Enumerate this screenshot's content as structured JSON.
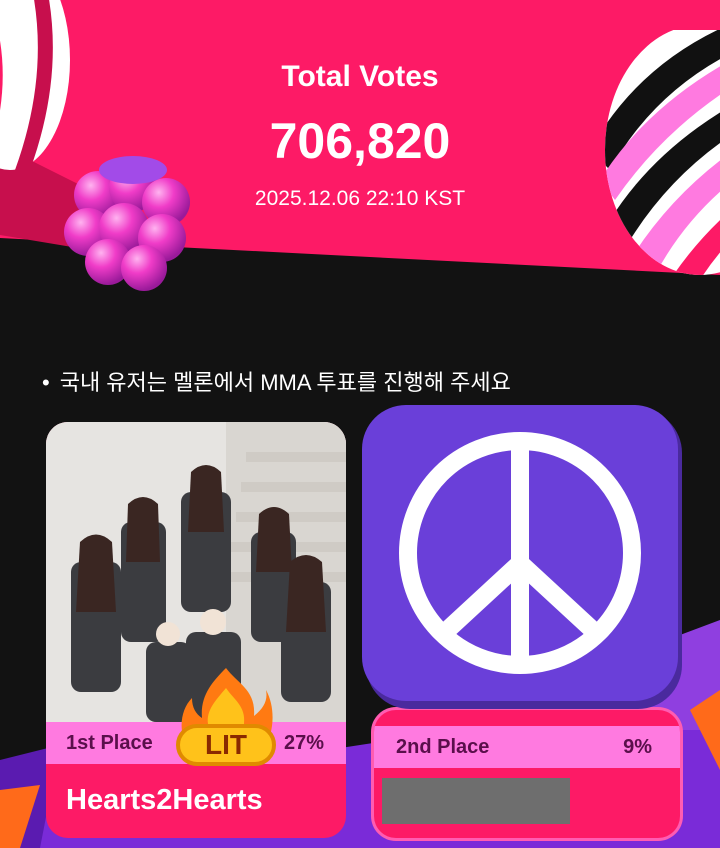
{
  "header": {
    "title": "Total Votes",
    "count": "706,820",
    "timestamp": "2025.12.06 22:10 KST"
  },
  "notice": {
    "bullet": "•",
    "text": "국내 유저는 멜론에서 MMA 투표를 진행해 주세요"
  },
  "candidates": [
    {
      "place": "1st Place",
      "percent": "27%",
      "name": "Hearts2Hearts",
      "badge": "LIT"
    },
    {
      "place": "2nd Place",
      "percent": "9%",
      "name": ""
    }
  ],
  "colors": {
    "banner_pink": "#fd1a66",
    "bar_pink": "#ff7ae0",
    "icon_purple": "#6a3fd9",
    "background": "#121212"
  },
  "icons": [
    "raspberry-icon",
    "peace-sign-icon",
    "fire-lit-badge-icon"
  ]
}
